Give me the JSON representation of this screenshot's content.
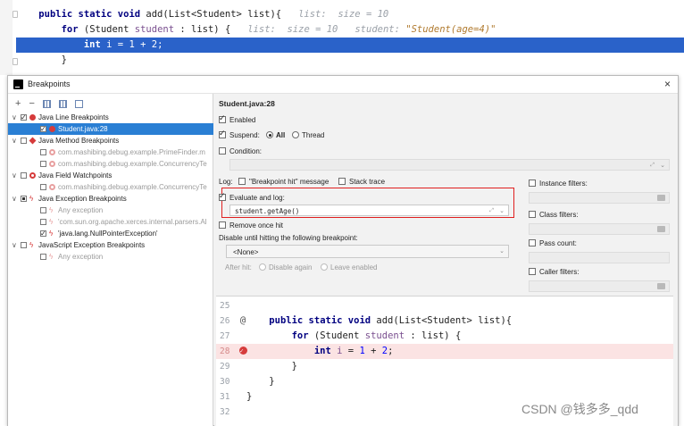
{
  "editor": {
    "lines": [
      {
        "indent": "    ",
        "code": "public static void add(List<Student> list){",
        "hint": "list:  size = 10"
      },
      {
        "indent": "        ",
        "code": "for (Student ",
        "var": "student",
        "code2": " : list) {",
        "hint": "list:  size = 10",
        "hint2": "student: ",
        "hint2_str": "\"Student(age=4)\""
      },
      {
        "indent": "            ",
        "code": "int i = 1 + 2;"
      },
      {
        "indent": "        ",
        "code": "}"
      }
    ]
  },
  "dialog": {
    "title": "Breakpoints",
    "close_glyph": "×"
  },
  "toolbar": {
    "add": "+",
    "remove": "−"
  },
  "tree": [
    {
      "label": "Java Line Breakpoints",
      "level": 0,
      "checked": "checked",
      "icon": "dot",
      "expanded": true
    },
    {
      "label": "Student.java:28",
      "level": 1,
      "checked": "checked",
      "icon": "dot",
      "selected": true
    },
    {
      "label": "Java Method Breakpoints",
      "level": 0,
      "checked": "none",
      "icon": "diamond",
      "expanded": true
    },
    {
      "label": "com.mashibing.debug.example.PrimeFinder.m",
      "level": 1,
      "checked": "none",
      "icon": "ring-light",
      "muted": true
    },
    {
      "label": "com.mashibing.debug.example.ConcurrencyTe",
      "level": 1,
      "checked": "none",
      "icon": "ring-light",
      "muted": true
    },
    {
      "label": "Java Field Watchpoints",
      "level": 0,
      "checked": "none",
      "icon": "ring",
      "expanded": true
    },
    {
      "label": "com.mashibing.debug.example.ConcurrencyTe",
      "level": 1,
      "checked": "none",
      "icon": "ring-light",
      "muted": true
    },
    {
      "label": "Java Exception Breakpoints",
      "level": 0,
      "checked": "partial",
      "icon": "bolt",
      "expanded": true
    },
    {
      "label": "Any exception",
      "level": 1,
      "checked": "none",
      "icon": "bolt-light",
      "muted": true
    },
    {
      "label": "'com.sun.org.apache.xerces.internal.parsers.Al",
      "level": 1,
      "checked": "none",
      "icon": "bolt-light",
      "muted": true
    },
    {
      "label": "'java.lang.NullPointerException'",
      "level": 1,
      "checked": "checked",
      "icon": "bolt"
    },
    {
      "label": "JavaScript Exception Breakpoints",
      "level": 0,
      "checked": "none",
      "icon": "bolt",
      "expanded": true
    },
    {
      "label": "Any exception",
      "level": 1,
      "checked": "none",
      "icon": "bolt-light",
      "muted": true
    }
  ],
  "details": {
    "header": "Student.java:28",
    "enabled_label": "Enabled",
    "suspend_label": "Suspend:",
    "suspend_all": "All",
    "suspend_thread": "Thread",
    "condition_label": "Condition:",
    "log_label": "Log:",
    "log_message": "\"Breakpoint hit\" message",
    "log_stack": "Stack trace",
    "evaluate_label": "Evaluate and log:",
    "evaluate_value": "student.getAge()",
    "remove_once": "Remove once hit",
    "disable_until": "Disable until hitting the following breakpoint:",
    "none_option": "<None>",
    "after_hit": "After hit:",
    "disable_again": "Disable again",
    "leave_enabled": "Leave enabled",
    "instance_filters": "Instance filters:",
    "class_filters": "Class filters:",
    "pass_count": "Pass count:",
    "caller_filters": "Caller filters:"
  },
  "preview": {
    "lines": [
      {
        "num": "25",
        "code": ""
      },
      {
        "num": "26",
        "code": "    public static void add(List<Student> list){",
        "gutter": "@"
      },
      {
        "num": "27",
        "code": "        for (Student student : list) {"
      },
      {
        "num": "28",
        "code": "            int i = 1 + 2;",
        "bp": true
      },
      {
        "num": "29",
        "code": "        }"
      },
      {
        "num": "30",
        "code": "    }"
      },
      {
        "num": "31",
        "code": "}"
      },
      {
        "num": "32",
        "code": ""
      }
    ]
  },
  "watermark": "CSDN @钱多多_qdd",
  "colors": {
    "selection": "#2a62c9",
    "breakpoint_red": "#d63b3b",
    "highlight_box": "#e02020"
  }
}
